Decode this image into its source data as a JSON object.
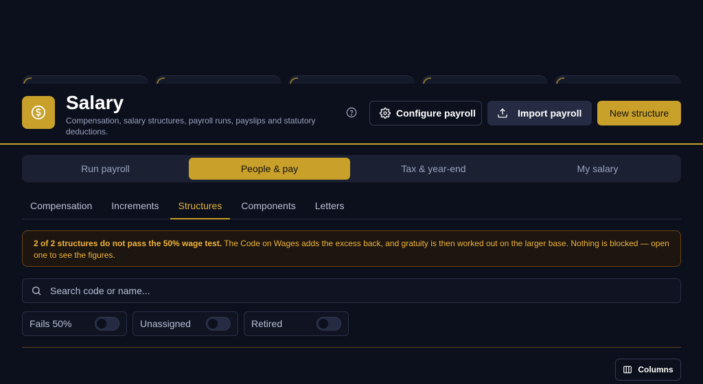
{
  "header": {
    "title": "Salary",
    "subtitle": "Compensation, salary structures, payroll runs, payslips and statutory deductions.",
    "buttons": {
      "configure": "Configure payroll",
      "import": "Import payroll",
      "new": "New structure"
    }
  },
  "segment_tabs": [
    {
      "label": "Run payroll",
      "active": false
    },
    {
      "label": "People & pay",
      "active": true
    },
    {
      "label": "Tax & year-end",
      "active": false
    },
    {
      "label": "My salary",
      "active": false
    }
  ],
  "sub_tabs": [
    {
      "label": "Compensation",
      "active": false
    },
    {
      "label": "Increments",
      "active": false
    },
    {
      "label": "Structures",
      "active": true
    },
    {
      "label": "Components",
      "active": false
    },
    {
      "label": "Letters",
      "active": false
    }
  ],
  "alert": {
    "bold": "2 of 2 structures do not pass the 50% wage test.",
    "text": " The Code on Wages adds the excess back, and gratuity is then worked out on the larger base. Nothing is blocked — open one to see the figures."
  },
  "search": {
    "placeholder": "Search code or name...",
    "value": ""
  },
  "filters": [
    {
      "label": "Fails 50%",
      "on": false
    },
    {
      "label": "Unassigned",
      "on": false
    },
    {
      "label": "Retired",
      "on": false
    }
  ],
  "columns_label": "Columns",
  "colors": {
    "accent": "#c9a02a",
    "background": "#0c0f1c",
    "alert_text": "#f0b43a"
  }
}
